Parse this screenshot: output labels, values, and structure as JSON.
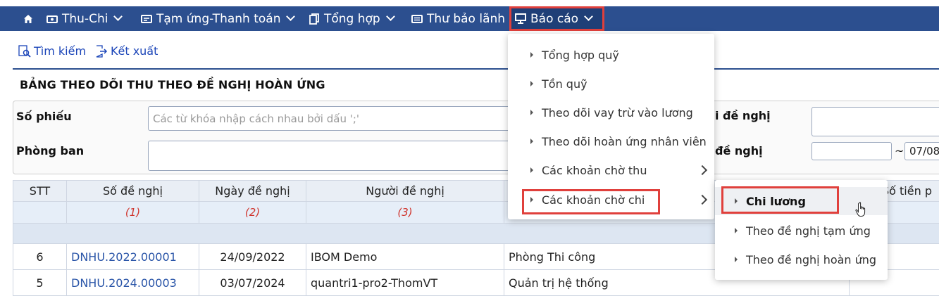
{
  "nav": {
    "home_icon": "home-icon",
    "items": [
      {
        "label": "Thu-Chi",
        "icon": "money-icon"
      },
      {
        "label": "Tạm ứng-Thanh toán",
        "icon": "advance-icon"
      },
      {
        "label": "Tổng hợp",
        "icon": "copy-icon"
      },
      {
        "label": "Thư bảo lãnh",
        "icon": "letter-icon"
      },
      {
        "label": "Báo cáo",
        "icon": "monitor-icon"
      }
    ]
  },
  "toolbar": {
    "search_label": "Tìm kiếm",
    "export_label": "Kết xuất"
  },
  "page": {
    "title": "BẢNG THEO DÕI THU THEO ĐỀ NGHỊ HOÀN ỨNG"
  },
  "filters": {
    "so_phieu_label": "Số phiếu",
    "so_phieu_placeholder": "Các từ khóa nhập cách nhau bởi dấu ';'",
    "phong_ban_label": "Phòng ban",
    "right_label_1": "i đề nghị",
    "right_label_2": "đề nghị",
    "date_separator": "~",
    "date_to_value": "07/08/"
  },
  "table": {
    "headers": [
      "STT",
      "Số đề nghị",
      "Ngày đề nghị",
      "Người đề nghị",
      "",
      "Số tiền p"
    ],
    "index_row": [
      "",
      "(1)",
      "(2)",
      "(3)",
      "",
      ""
    ],
    "rows": [
      {
        "stt": "6",
        "so": "DNHU.2022.00001",
        "ngay": "24/09/2022",
        "nguoi": "IBOM Demo",
        "phong": "Phòng Thi công",
        "tien": ""
      },
      {
        "stt": "5",
        "so": "DNHU.2024.00003",
        "ngay": "03/07/2024",
        "nguoi": "quantri1-pro2-ThomVT",
        "phong": "Quản trị hệ thống",
        "tien": ""
      }
    ]
  },
  "bao_cao_menu": {
    "items": [
      "Tổng hợp quỹ",
      "Tồn quỹ",
      "Theo dõi vay trừ vào lương",
      "Theo dõi hoàn ứng nhân viên",
      "Các khoản chờ thu",
      "Các khoản chờ chi"
    ]
  },
  "submenu": {
    "items": [
      "Chi lương",
      "Theo đề nghị tạm ứng",
      "Theo đề nghị hoàn ứng"
    ]
  },
  "colors": {
    "nav_bg": "#2c4f8f",
    "highlight": "#e0403c",
    "link": "#1a44b8"
  }
}
